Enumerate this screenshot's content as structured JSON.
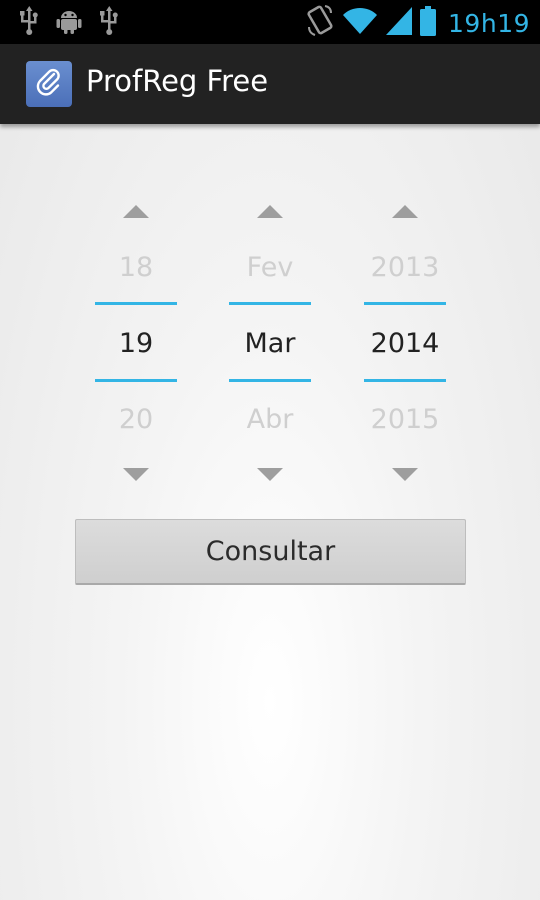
{
  "status_bar": {
    "time": "19h19",
    "left_icons": [
      "usb-icon",
      "android-debug-icon",
      "usb-icon"
    ],
    "right_icons": [
      "auto-rotate-icon",
      "wifi-icon",
      "signal-icon",
      "battery-icon"
    ],
    "accent_color": "#33b5e5"
  },
  "action_bar": {
    "title": "ProfReg Free",
    "icon": "paperclip-icon"
  },
  "date_picker": {
    "day": {
      "prev": "18",
      "current": "19",
      "next": "20"
    },
    "month": {
      "prev": "Fev",
      "current": "Mar",
      "next": "Abr"
    },
    "year": {
      "prev": "2013",
      "current": "2014",
      "next": "2015"
    }
  },
  "consult_button": {
    "label": "Consultar"
  }
}
